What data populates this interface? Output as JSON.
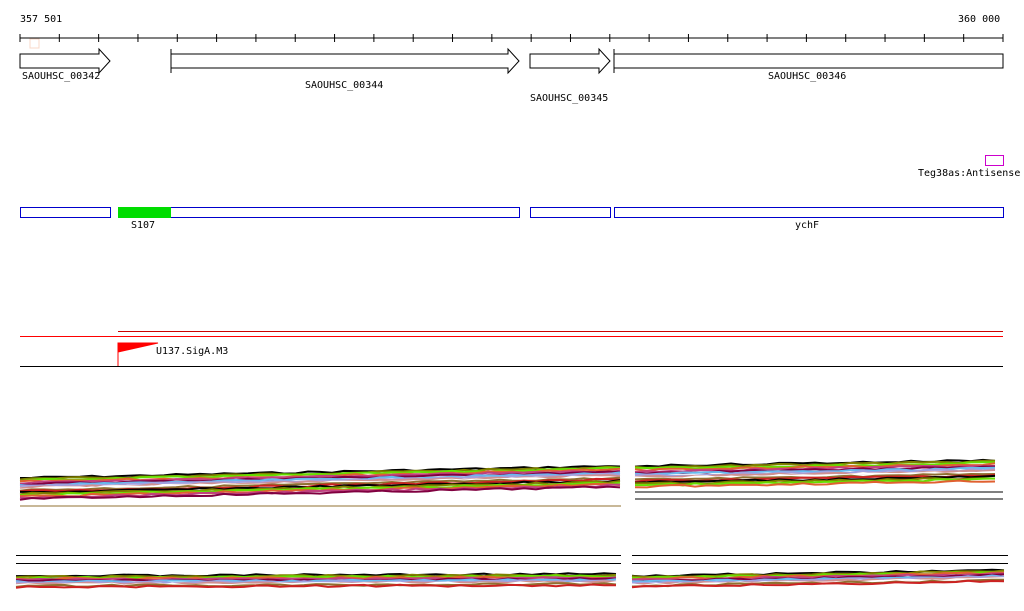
{
  "ruler": {
    "start_label": "357 501",
    "end_label": "360 000"
  },
  "genes": [
    {
      "label": "SAOUHSC_00342",
      "strand": "+"
    },
    {
      "label": "SAOUHSC_00344",
      "strand": "+"
    },
    {
      "label": "SAOUHSC_00345",
      "strand": "+"
    },
    {
      "label": "SAOUHSC_00346",
      "strand": "+"
    }
  ],
  "antisense": {
    "label": "Teg38as:Antisense",
    "color": "#cc00cc"
  },
  "transcripts": [
    {
      "label": "S107",
      "highlight_color": "#00dd00"
    },
    {
      "label": "ychF"
    }
  ],
  "promoter": {
    "label": "U137.SigA.M3",
    "color": "#ff0000"
  },
  "expression_colors": [
    "#000000",
    "#808000",
    "#66dd00",
    "#e06030",
    "#c04080",
    "#800040",
    "#66bbee",
    "#a0a0e0",
    "#d09090",
    "#ffffff",
    "#907030",
    "#cc2222"
  ]
}
